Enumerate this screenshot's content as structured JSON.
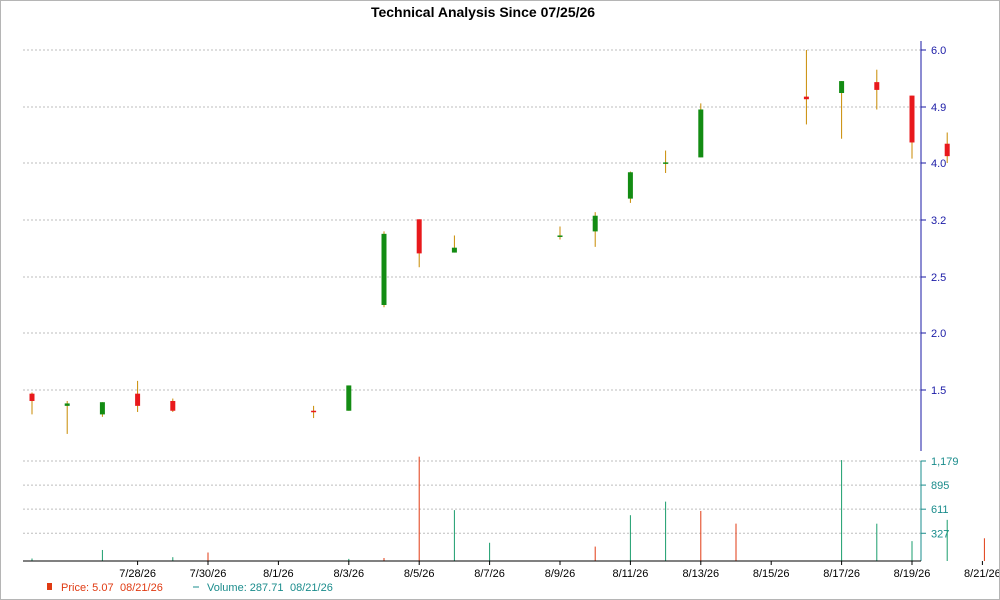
{
  "chart_data": [
    {
      "type": "candlestick",
      "title": "Technical Analysis Since 07/25/26",
      "dates": [
        "7/25/26",
        "7/26/26",
        "7/27/26",
        "7/28/26",
        "7/29/26",
        "7/30/26",
        "7/31/26",
        "8/1/26",
        "8/2/26",
        "8/3/26",
        "8/4/26",
        "8/5/26",
        "8/6/26",
        "8/7/26",
        "8/8/26",
        "8/9/26",
        "8/10/26",
        "8/11/26",
        "8/12/26",
        "8/13/26",
        "8/14/26",
        "8/15/26",
        "8/16/26",
        "8/17/26",
        "8/18/26",
        "8/19/26",
        "8/20/26",
        "8/21/26"
      ],
      "x_tick_labels": [
        "7/28/26",
        "7/30/26",
        "8/1/26",
        "8/3/26",
        "8/5/26",
        "8/7/26",
        "8/9/26",
        "8/11/26",
        "8/13/26",
        "8/15/26",
        "8/17/26",
        "8/19/26",
        "8/21/26"
      ],
      "candles": [
        {
          "date": "7/25/26",
          "open": 1.47,
          "high": 1.48,
          "low": 1.3,
          "close": 1.41
        },
        {
          "date": "7/26/26",
          "open": 1.37,
          "high": 1.41,
          "low": 1.14,
          "close": 1.39
        },
        {
          "date": "7/27/26",
          "open": 1.3,
          "high": 1.4,
          "low": 1.28,
          "close": 1.4
        },
        {
          "date": "7/28/26",
          "open": 1.47,
          "high": 1.58,
          "low": 1.32,
          "close": 1.37
        },
        {
          "date": "7/29/26",
          "open": 1.41,
          "high": 1.43,
          "low": 1.32,
          "close": 1.33
        },
        {
          "date": "8/2/26",
          "open": 1.33,
          "high": 1.37,
          "low": 1.27,
          "close": 1.32
        },
        {
          "date": "8/3/26",
          "open": 1.33,
          "high": 1.54,
          "low": 1.33,
          "close": 1.54
        },
        {
          "date": "8/4/26",
          "open": 2.25,
          "high": 3.06,
          "low": 2.23,
          "close": 3.03
        },
        {
          "date": "8/5/26",
          "open": 3.21,
          "high": 3.21,
          "low": 2.62,
          "close": 2.79
        },
        {
          "date": "8/6/26",
          "open": 2.8,
          "high": 3.01,
          "low": 2.8,
          "close": 2.86
        },
        {
          "date": "8/9/26",
          "open": 3.01,
          "high": 3.12,
          "low": 2.96,
          "close": 3.01
        },
        {
          "date": "8/10/26",
          "open": 3.06,
          "high": 3.31,
          "low": 2.87,
          "close": 3.26
        },
        {
          "date": "8/11/26",
          "open": 3.5,
          "high": 3.88,
          "low": 3.44,
          "close": 3.87
        },
        {
          "date": "8/12/26",
          "open": 4.01,
          "high": 4.2,
          "low": 3.86,
          "close": 4.01
        },
        {
          "date": "8/13/26",
          "open": 4.09,
          "high": 4.97,
          "low": 4.09,
          "close": 4.86
        },
        {
          "date": "8/16/26",
          "open": 5.1,
          "high": 6.0,
          "low": 4.62,
          "close": 5.05
        },
        {
          "date": "8/17/26",
          "open": 5.17,
          "high": 5.4,
          "low": 4.39,
          "close": 5.4
        },
        {
          "date": "8/18/26",
          "open": 5.38,
          "high": 5.62,
          "low": 4.86,
          "close": 5.23
        },
        {
          "date": "8/19/26",
          "open": 5.12,
          "high": 5.12,
          "low": 4.07,
          "close": 4.33
        },
        {
          "date": "8/20/26",
          "open": 4.31,
          "high": 4.49,
          "low": 4.0,
          "close": 4.11
        }
      ],
      "y_ticks": [
        {
          "value": 1.5,
          "label": "1.5"
        },
        {
          "value": 2.0,
          "label": "2.0"
        },
        {
          "value": 2.5,
          "label": "2.5"
        },
        {
          "value": 3.2,
          "label": "3.2"
        },
        {
          "value": 4.0,
          "label": "4.0"
        },
        {
          "value": 4.9,
          "label": "4.9"
        },
        {
          "value": 6.0,
          "label": "6.0"
        }
      ],
      "up_color": "#138c13",
      "down_color": "#e8191c",
      "wick_color": "#c88a00",
      "grid": true
    },
    {
      "type": "bar",
      "series_name": "Volume",
      "dates": [
        "7/25/26",
        "7/27/26",
        "7/29/26",
        "7/30/26",
        "8/3/26",
        "8/4/26",
        "8/5/26",
        "8/6/26",
        "8/7/26",
        "8/10/26",
        "8/11/26",
        "8/12/26",
        "8/13/26",
        "8/14/26",
        "8/17/26",
        "8/18/26",
        "8/19/26",
        "8/20/26",
        "8/21/26"
      ],
      "values": [
        30,
        130,
        45,
        100,
        25,
        35,
        1230,
        600,
        215,
        170,
        540,
        700,
        590,
        440,
        1190,
        440,
        235,
        485,
        268
      ],
      "colors": [
        "#1a9c6c",
        "#1a9c6c",
        "#1a9c6c",
        "#e03a12",
        "#1a9c6c",
        "#e03a12",
        "#e03a12",
        "#1a9c6c",
        "#1a9c6c",
        "#e03a12",
        "#1a9c6c",
        "#1a9c6c",
        "#e03a12",
        "#e03a12",
        "#1a9c6c",
        "#1a9c6c",
        "#1a9c6c",
        "#1a9c6c",
        "#e03a12"
      ],
      "y_ticks": [
        {
          "value": 327,
          "label": "327"
        },
        {
          "value": 611,
          "label": "611"
        },
        {
          "value": 895,
          "label": "895"
        },
        {
          "value": 1179,
          "label": "1,179"
        }
      ],
      "grid": true
    }
  ],
  "legend": {
    "price_label": "Price: 5.07",
    "price_date": "08/21/26",
    "volume_label": "Volume: 287.71",
    "volume_date": "08/21/26",
    "price_color": "#e03a12",
    "volume_color": "#1a8c8c"
  }
}
